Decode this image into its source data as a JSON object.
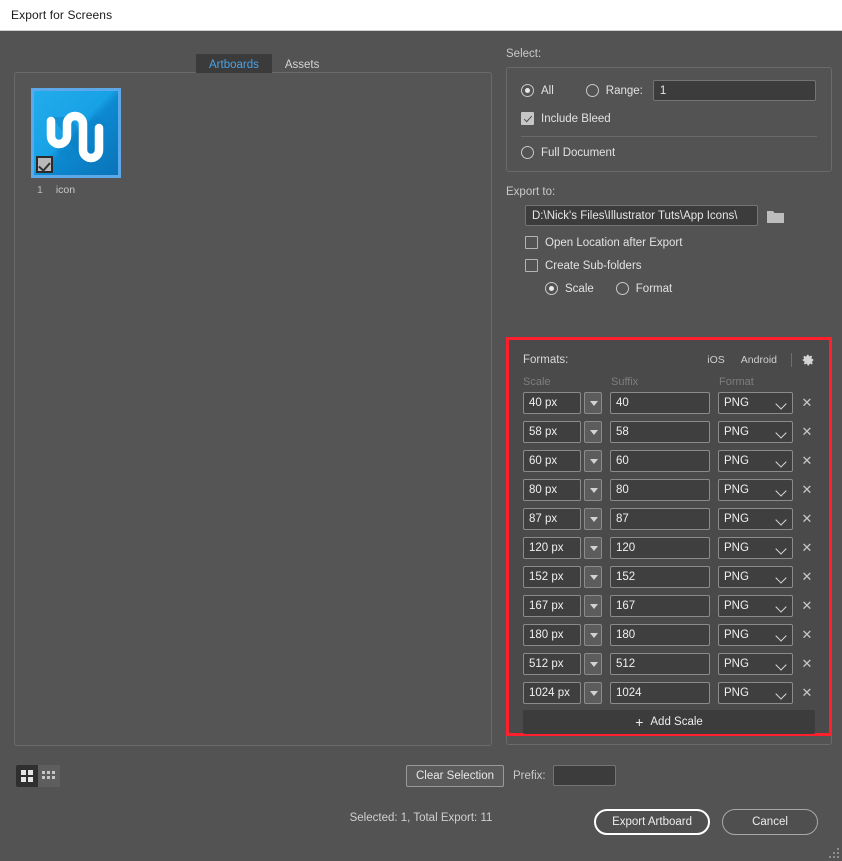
{
  "window": {
    "title": "Export for Screens"
  },
  "tabs": [
    {
      "label": "Artboards",
      "active": true
    },
    {
      "label": "Assets",
      "active": false
    }
  ],
  "artboards": [
    {
      "number": "1",
      "name": "icon",
      "selected": true
    }
  ],
  "view_modes": {
    "grid_icon": "grid-view-icon",
    "list_icon": "list-view-icon",
    "active": "grid"
  },
  "clear_selection_label": "Clear Selection",
  "select": {
    "heading": "Select:",
    "all_label": "All",
    "all_checked": true,
    "range_label": "Range:",
    "range_checked": false,
    "range_value": "1",
    "include_bleed_label": "Include Bleed",
    "include_bleed_checked": true,
    "full_document_label": "Full Document",
    "full_document_checked": false
  },
  "export_to": {
    "heading": "Export to:",
    "path": "D:\\Nick's Files\\Illustrator Tuts\\App Icons\\",
    "folder_icon": "folder-icon",
    "open_location_label": "Open Location after Export",
    "open_location_checked": false,
    "create_subfolders_label": "Create Sub-folders",
    "create_subfolders_checked": false,
    "scale_label": "Scale",
    "scale_checked": true,
    "format_label": "Format",
    "format_checked": false
  },
  "formats": {
    "heading": "Formats:",
    "ios_label": "iOS",
    "android_label": "Android",
    "gear_icon": "gear-icon",
    "columns": {
      "scale": "Scale",
      "suffix": "Suffix",
      "format": "Format"
    },
    "rows": [
      {
        "scale": "40 px",
        "suffix": "40",
        "format": "PNG"
      },
      {
        "scale": "58 px",
        "suffix": "58",
        "format": "PNG"
      },
      {
        "scale": "60 px",
        "suffix": "60",
        "format": "PNG"
      },
      {
        "scale": "80 px",
        "suffix": "80",
        "format": "PNG"
      },
      {
        "scale": "87 px",
        "suffix": "87",
        "format": "PNG"
      },
      {
        "scale": "120 px",
        "suffix": "120",
        "format": "PNG"
      },
      {
        "scale": "152 px",
        "suffix": "152",
        "format": "PNG"
      },
      {
        "scale": "167 px",
        "suffix": "167",
        "format": "PNG"
      },
      {
        "scale": "180 px",
        "suffix": "180",
        "format": "PNG"
      },
      {
        "scale": "512 px",
        "suffix": "512",
        "format": "PNG"
      },
      {
        "scale": "1024 px",
        "suffix": "1024",
        "format": "PNG"
      }
    ],
    "add_scale_label": "Add Scale",
    "add_scale_plus": "+",
    "highlight_color": "#ff1f2d"
  },
  "prefix": {
    "label": "Prefix:",
    "value": ""
  },
  "footer": {
    "status": "Selected: 1, Total Export: 11",
    "export_button": "Export Artboard",
    "cancel_button": "Cancel"
  },
  "theme": {
    "background": "#535353",
    "panel": "#4a4a4a",
    "accent": "#4aa3e8",
    "icon_blue": "#1ea8ea"
  }
}
